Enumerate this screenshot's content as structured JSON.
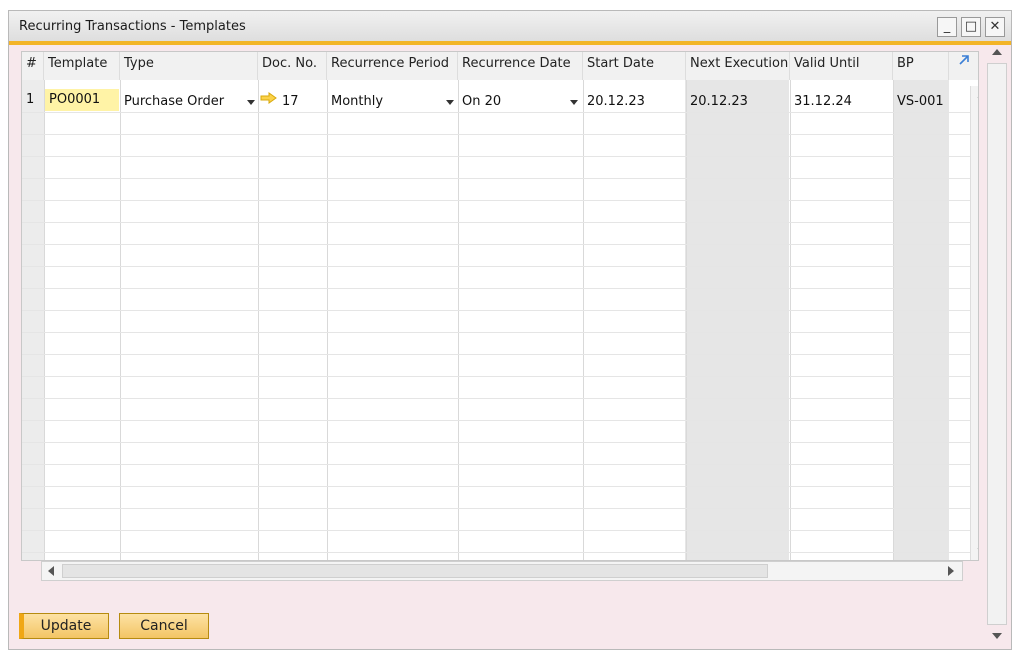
{
  "window": {
    "title": "Recurring Transactions - Templates",
    "min_glyph": "_",
    "max_glyph": "□",
    "close_glyph": "✕"
  },
  "columns": [
    {
      "label": "#"
    },
    {
      "label": "Template"
    },
    {
      "label": "Type"
    },
    {
      "label": "Doc. No."
    },
    {
      "label": "Recurrence Period"
    },
    {
      "label": "Recurrence Date"
    },
    {
      "label": "Start Date"
    },
    {
      "label": "Next Execution"
    },
    {
      "label": "Valid Until"
    },
    {
      "label": "BP"
    }
  ],
  "rows": [
    {
      "num": "1",
      "template": "PO0001",
      "type": "Purchase Order",
      "doc_no": "17",
      "recurrence_period": "Monthly",
      "recurrence_date": "On 20",
      "start_date": "20.12.23",
      "next_execution": "20.12.23",
      "valid_until": "31.12.24",
      "bp": "VS-001"
    }
  ],
  "buttons": {
    "update": "Update",
    "cancel": "Cancel"
  },
  "icons": {
    "link_arrow": "link-arrow-icon",
    "expand": "expand-icon",
    "dropdown": "dropdown-arrow-icon"
  }
}
